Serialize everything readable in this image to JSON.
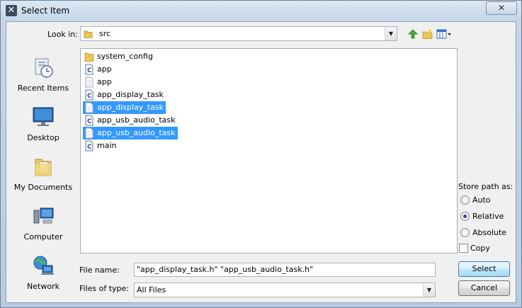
{
  "window": {
    "title": "Select Item",
    "close_label": "✕"
  },
  "lookin": {
    "label": "Look in:",
    "value": "src"
  },
  "toolbar": {
    "icons": [
      "up-folder-icon",
      "new-folder-icon",
      "view-menu-icon"
    ]
  },
  "places": [
    {
      "label": "Recent Items"
    },
    {
      "label": "Desktop"
    },
    {
      "label": "My Documents"
    },
    {
      "label": "Computer"
    },
    {
      "label": "Network"
    }
  ],
  "files": [
    {
      "name": "system_config",
      "type": "folder",
      "selected": false
    },
    {
      "name": "app",
      "type": "c-file",
      "selected": false
    },
    {
      "name": "app",
      "type": "h-file",
      "selected": false
    },
    {
      "name": "app_display_task",
      "type": "c-file",
      "selected": false
    },
    {
      "name": "app_display_task",
      "type": "h-file",
      "selected": true
    },
    {
      "name": "app_usb_audio_task",
      "type": "c-file",
      "selected": false
    },
    {
      "name": "app_usb_audio_task",
      "type": "h-file",
      "selected": true
    },
    {
      "name": "main",
      "type": "c-file",
      "selected": false
    }
  ],
  "filename": {
    "label": "File name:",
    "value": "\"app_display_task.h\" \"app_usb_audio_task.h\""
  },
  "filetype": {
    "label": "Files of type:",
    "value": "All Files"
  },
  "store_path": {
    "label": "Store path as:",
    "options": [
      {
        "label": "Auto",
        "checked": false
      },
      {
        "label": "Relative",
        "checked": true
      },
      {
        "label": "Absolute",
        "checked": false
      }
    ]
  },
  "copy": {
    "label": "Copy",
    "checked": false
  },
  "buttons": {
    "select": "Select",
    "cancel": "Cancel"
  },
  "colors": {
    "selection": "#3399ff",
    "folder": "#e8c65a"
  }
}
